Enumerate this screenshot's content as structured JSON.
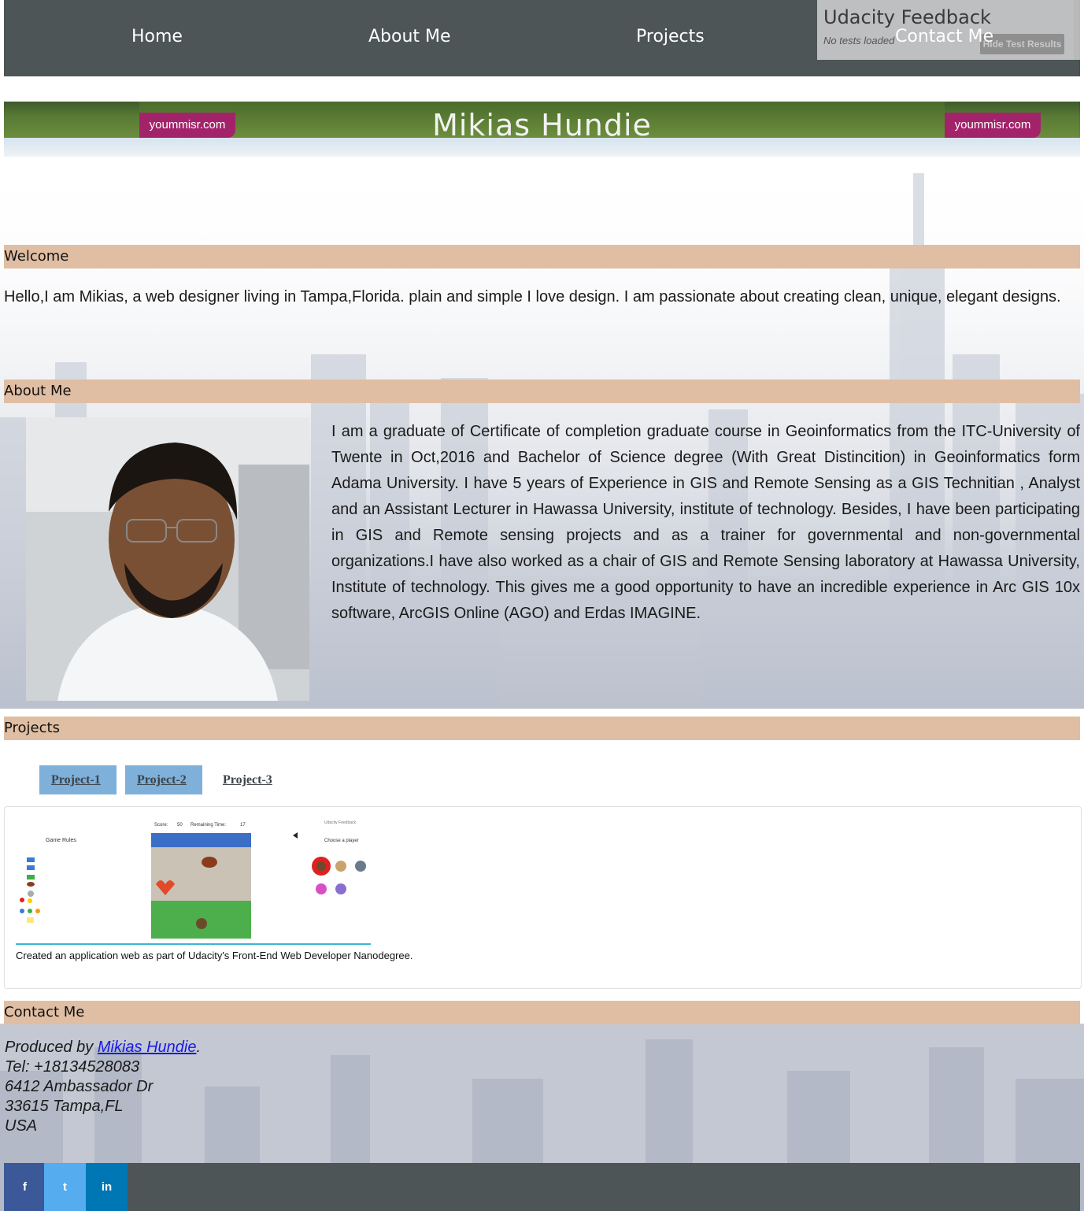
{
  "nav": {
    "items": [
      "Home",
      "About Me",
      "Projects",
      "Contact Me"
    ]
  },
  "feedback": {
    "title": "Udacity Feedback",
    "status": "No tests loaded",
    "button": "Hide Test Results"
  },
  "banner": {
    "title": "Mikias Hundie",
    "watermark": "yoummisr.com"
  },
  "sections": {
    "welcome": "Welcome",
    "about": "About Me",
    "projects": "Projects",
    "contact": "Contact Me"
  },
  "welcome_text": "Hello,I am Mikias, a web designer living in Tampa,Florida. plain and simple I love design. I am passionate about creating clean, unique, elegant designs.",
  "about_text": "I am a graduate of Certificate of completion graduate course in Geoinformatics from the ITC-University of Twente in Oct,2016 and Bachelor of Science degree (With Great Distincition) in Geoinformatics form Adama University. I have 5 years of Experience in GIS and Remote Sensing as a GIS Technitian , Analyst and an Assistant Lecturer in Hawassa University, institute of technology. Besides, I have been participating in GIS and Remote sensing projects and as a trainer for governmental and non-governmental organizations.I have also worked as a chair of GIS and Remote Sensing laboratory at Hawassa University, Institute of technology. This gives me a good opportunity to have an incredible experience in Arc GIS 10x software, ArcGIS Online (AGO) and Erdas IMAGINE.",
  "projects": {
    "tabs": [
      "Project-1",
      "Project-2",
      "Project-3"
    ],
    "caption": "Created an application web as part of Udacity's Front-End Web Developer Nanodegree.",
    "preview": {
      "rules_title": "Game Rules",
      "score_label": "Score:",
      "score_value": "50",
      "time_label": "Remaining Time:",
      "time_value": "17",
      "choose_player": "Choose a player",
      "mini_feedback": "Udacity Feedback"
    }
  },
  "contact": {
    "produced_by": "Produced by",
    "name_link": "Mikias Hundie",
    "period": ".",
    "tel": "Tel: +18134528083",
    "street": "6412 Ambassador Dr",
    "city": "33615 Tampa,FL",
    "country": "USA"
  },
  "social": {
    "facebook": "f",
    "twitter": "t",
    "linkedin": "in",
    "colors": {
      "facebook": "#3b5998",
      "twitter": "#55acee",
      "linkedin": "#0077b5"
    }
  },
  "colors": {
    "nav_bg": "#4d5556",
    "section_header": "#e0bea3",
    "tab_active": "#7eb0d9"
  }
}
